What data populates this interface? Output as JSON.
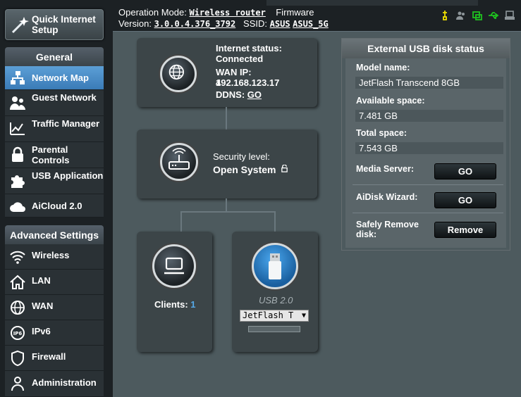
{
  "header": {
    "operation_mode_label": "Operation Mode:",
    "operation_mode_value": "Wireless router",
    "firmware_label": "Firmware",
    "version_label": "Version:",
    "version_value": "3.0.0.4.376_3792",
    "ssid_label": "SSID:",
    "ssid_1": "ASUS",
    "ssid_2": "ASUS_5G",
    "status_icons": [
      "usb-status-icon",
      "clients-icon",
      "wifi-status-icon",
      "usb-connected-icon",
      "printer-icon"
    ]
  },
  "sidebar": {
    "quick_setup_label": "Quick Internet Setup",
    "general_head": "General",
    "general_items": [
      {
        "label": "Network Map",
        "icon": "network-map-icon",
        "active": true
      },
      {
        "label": "Guest Network",
        "icon": "guest-network-icon"
      },
      {
        "label": "Traffic Manager",
        "icon": "traffic-manager-icon"
      },
      {
        "label": "Parental Controls",
        "icon": "lock-icon"
      },
      {
        "label": "USB Application",
        "icon": "puzzle-icon"
      },
      {
        "label": "AiCloud 2.0",
        "icon": "cloud-icon"
      }
    ],
    "advanced_head": "Advanced Settings",
    "advanced_items": [
      {
        "label": "Wireless",
        "icon": "wifi-icon"
      },
      {
        "label": "LAN",
        "icon": "house-icon"
      },
      {
        "label": "WAN",
        "icon": "globe-icon"
      },
      {
        "label": "IPv6",
        "icon": "ipv6-icon"
      },
      {
        "label": "Firewall",
        "icon": "shield-icon"
      },
      {
        "label": "Administration",
        "icon": "person-icon"
      }
    ]
  },
  "map": {
    "internet_status_label": "Internet status:",
    "internet_status_value": "Connected",
    "wan_ip_label": "WAN IP:",
    "wan_ip_value": "192.168.123.17",
    "wan_ip_wrap": "4",
    "ddns_label": "DDNS:",
    "ddns_link": "GO",
    "security_label": "Security level:",
    "security_value": "Open System",
    "clients_label": "Clients:",
    "clients_count": "1",
    "usb_label": "USB 2.0",
    "usb_select_value": "JetFlash T"
  },
  "usb_status": {
    "title": "External USB disk status",
    "model_label": "Model name:",
    "model_value": "JetFlash Transcend 8GB",
    "available_label": "Available space:",
    "available_value": "7.481 GB",
    "total_label": "Total space:",
    "total_value": "7.543 GB",
    "media_label": "Media Server:",
    "media_button": "GO",
    "aidisk_label": "AiDisk Wizard:",
    "aidisk_button": "GO",
    "remove_label_1": "Safely Remove",
    "remove_label_2": "disk:",
    "remove_button": "Remove"
  },
  "colors": {
    "accent_blue": "#3a7bb7",
    "clients_count": "#56a9e8",
    "panel": "#4d5a5e",
    "sidebar_bg": "#1c2124"
  }
}
